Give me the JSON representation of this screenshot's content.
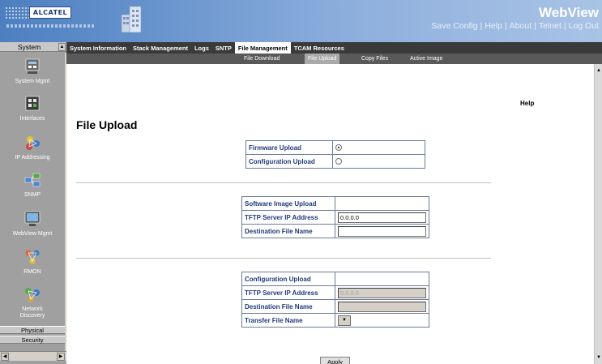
{
  "header": {
    "brand": "ALCATEL",
    "product": "WebView",
    "links": [
      "Save Config",
      "Help",
      "About",
      "Telnet",
      "Log Out"
    ]
  },
  "sidebar": {
    "section": "System",
    "items": [
      {
        "label": "System Mgmt",
        "icon": "system-mgmt-icon"
      },
      {
        "label": "Interfaces",
        "icon": "interfaces-icon"
      },
      {
        "label": "IP Addressing",
        "icon": "ip-addressing-icon"
      },
      {
        "label": "SNMP",
        "icon": "snmp-icon"
      },
      {
        "label": "WebView Mgmt",
        "icon": "webview-mgmt-icon"
      },
      {
        "label": "RMON",
        "icon": "rmon-icon"
      },
      {
        "label": "Network Discovery",
        "icon": "network-discovery-icon"
      }
    ],
    "tabs": [
      "Physical",
      "Security"
    ]
  },
  "tabs": [
    "System Information",
    "Stack Management",
    "Logs",
    "SNTP",
    "File Management",
    "TCAM Resources"
  ],
  "active_tab": "File Management",
  "subtabs": [
    "File Download",
    "File Upload",
    "Copy Files",
    "Active Image"
  ],
  "active_subtab": "File Upload",
  "page": {
    "title": "File Upload",
    "help": "Help",
    "upload_type": {
      "firmware_label": "Firmware Upload",
      "config_label": "Configuration Upload",
      "selected": "Firmware Upload"
    },
    "software": {
      "header": "Software Image Upload",
      "tftp_label": "TFTP Server IP Address",
      "tftp_value": "0.0.0.0",
      "dest_label": "Destination File Name",
      "dest_value": ""
    },
    "configuration": {
      "header": "Configuration Upload",
      "tftp_label": "TFTP Server IP Address",
      "tftp_value": "0.0.0.0",
      "dest_label": "Destination File Name",
      "dest_value": "",
      "transfer_label": "Transfer File Name",
      "transfer_value": ""
    },
    "apply_label": "Apply"
  },
  "colors": {
    "header_blue": "#4d7fc0",
    "tabbar": "#3a3a3a",
    "subtabbar": "#595959",
    "label_text": "#1f3a7a"
  }
}
